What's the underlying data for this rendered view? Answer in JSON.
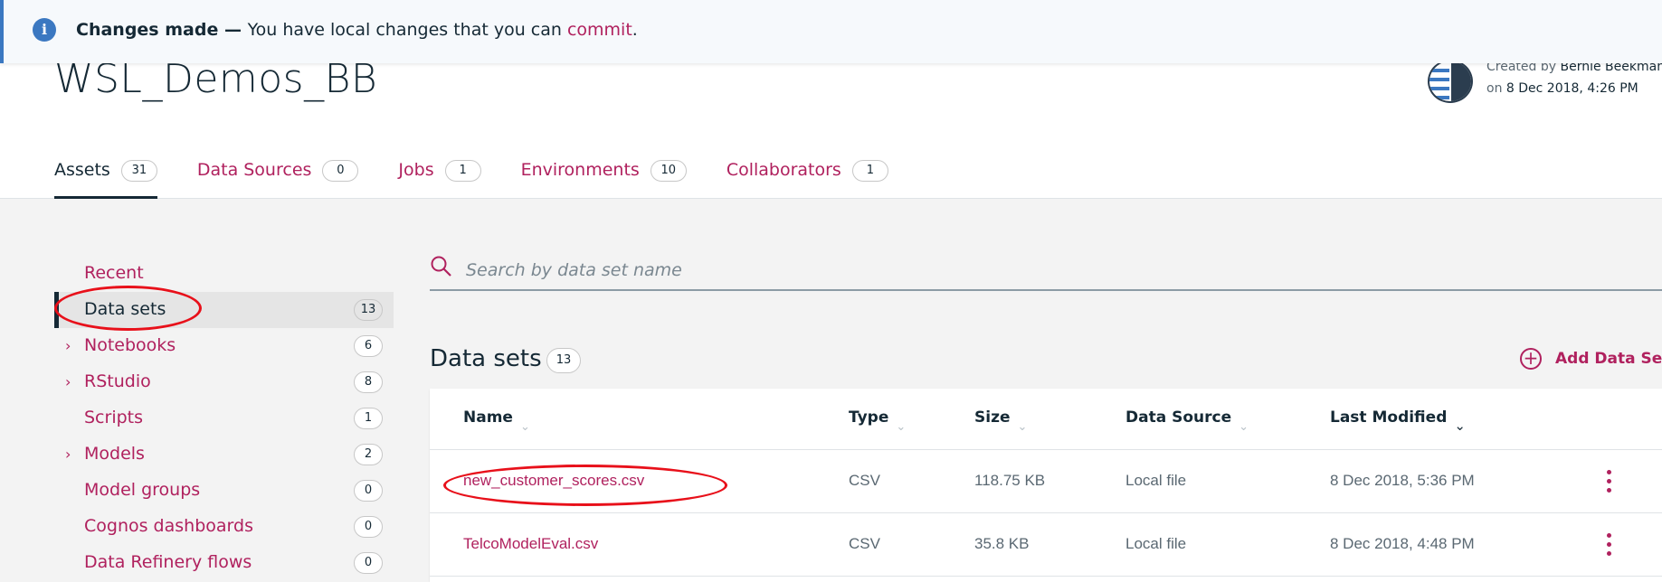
{
  "banner": {
    "strong": "Changes made",
    "dash": " — ",
    "text": "You have local changes that you can ",
    "link": "commit",
    "end": "."
  },
  "project": {
    "title": "WSL_Demos_BB",
    "created_by_label": "Created by",
    "created_by": "Bernie Beekman",
    "on_label": "on",
    "created_on": "8 Dec 2018, 4:26 PM"
  },
  "tabs": [
    {
      "label": "Assets",
      "count": "31"
    },
    {
      "label": "Data Sources",
      "count": "0"
    },
    {
      "label": "Jobs",
      "count": "1"
    },
    {
      "label": "Environments",
      "count": "10"
    },
    {
      "label": "Collaborators",
      "count": "1"
    }
  ],
  "sidebar": {
    "items": [
      {
        "label": "Recent",
        "count": ""
      },
      {
        "label": "Data sets",
        "count": "13"
      },
      {
        "label": "Notebooks",
        "count": "6"
      },
      {
        "label": "RStudio",
        "count": "8"
      },
      {
        "label": "Scripts",
        "count": "1"
      },
      {
        "label": "Models",
        "count": "2"
      },
      {
        "label": "Model groups",
        "count": "0"
      },
      {
        "label": "Cognos dashboards",
        "count": "0"
      },
      {
        "label": "Data Refinery flows",
        "count": "0"
      }
    ]
  },
  "search": {
    "placeholder": "Search by data set name"
  },
  "datasets": {
    "title": "Data sets",
    "count": "13",
    "add_label": "Add Data Set",
    "columns": [
      "Name",
      "Type",
      "Size",
      "Data Source",
      "Last Modified"
    ],
    "rows": [
      {
        "name": "new_customer_scores.csv",
        "type": "CSV",
        "size": "118.75 KB",
        "source": "Local file",
        "modified": "8 Dec 2018, 5:36 PM"
      },
      {
        "name": "TelcoModelEval.csv",
        "type": "CSV",
        "size": "35.8 KB",
        "source": "Local file",
        "modified": "8 Dec 2018, 4:48 PM"
      }
    ]
  },
  "icons": {
    "info": "info-icon",
    "search": "search-icon",
    "chevron": "chevron-right-icon",
    "sort": "sort-chevron-icon",
    "add": "add-circle-icon",
    "overflow": "overflow-menu-icon"
  },
  "colors": {
    "link": "#b0215e",
    "text": "#152935",
    "info": "#3b78c1",
    "annotation": "#e8101a"
  }
}
